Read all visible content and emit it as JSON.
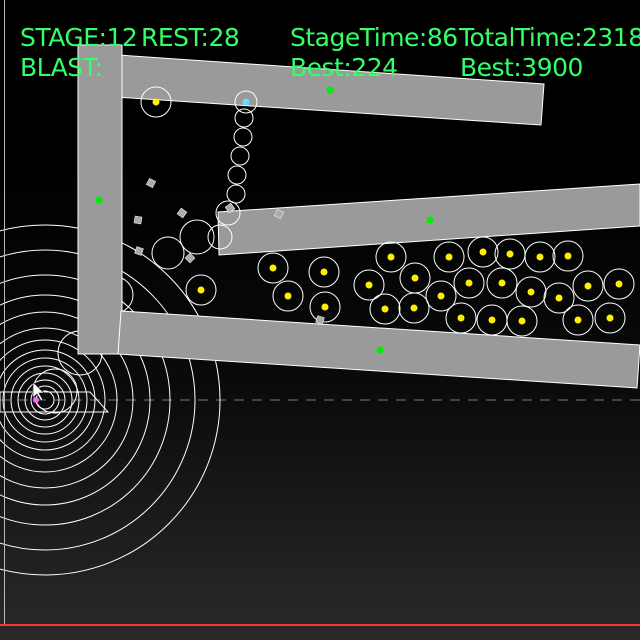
{
  "hud": {
    "stage": "STAGE:12",
    "rest": "REST:28",
    "blast": "BLAST:",
    "stage_time": "StageTime:86",
    "stage_best": "Best:224",
    "total_time": "TotalTime:2318",
    "total_best": "Best:3900"
  },
  "colors": {
    "hud_text": "#33ff66",
    "plank": "#9a9a9a",
    "ball_outline": "#ffffff",
    "ball_core": "#ffee00",
    "anchor": "#00ee00",
    "target_core": "#66ddff",
    "cursor": "#ff66ff",
    "bottom_line": "#ff3333"
  }
}
